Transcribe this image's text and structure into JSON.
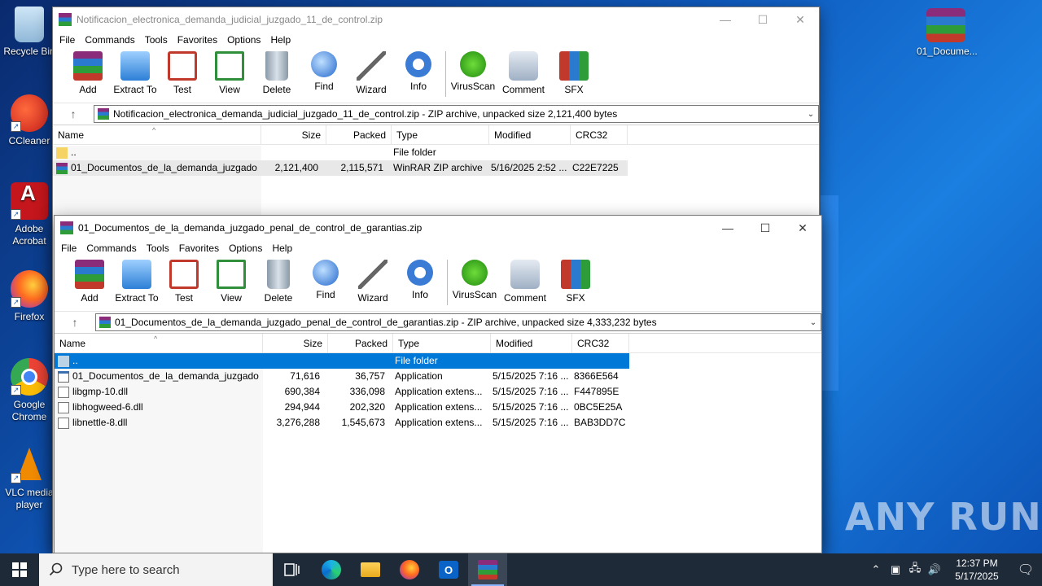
{
  "desktop": {
    "icons": [
      {
        "label": "Recycle Bin"
      },
      {
        "label": "CCleaner"
      },
      {
        "label": "Adobe Acrobat"
      },
      {
        "label": "Firefox"
      },
      {
        "label": "Google Chrome"
      },
      {
        "label": "VLC media player"
      }
    ],
    "file_icon_label": "01_Docume...",
    "watermark": "ANY RUN"
  },
  "window1": {
    "title": "Notificacion_electronica_demanda_judicial_juzgado_11_de_control.zip",
    "menu": [
      "File",
      "Commands",
      "Tools",
      "Favorites",
      "Options",
      "Help"
    ],
    "toolbar": [
      "Add",
      "Extract To",
      "Test",
      "View",
      "Delete",
      "Find",
      "Wizard",
      "Info",
      "VirusScan",
      "Comment",
      "SFX"
    ],
    "address": "Notificacion_electronica_demanda_judicial_juzgado_11_de_control.zip - ZIP archive, unpacked size 2,121,400 bytes",
    "columns": [
      "Name",
      "Size",
      "Packed",
      "Type",
      "Modified",
      "CRC32"
    ],
    "rows": [
      {
        "name": "..",
        "size": "",
        "packed": "",
        "type": "File folder",
        "modified": "",
        "crc": ""
      },
      {
        "name": "01_Documentos_de_la_demanda_juzgado...",
        "size": "2,121,400",
        "packed": "2,115,571",
        "type": "WinRAR ZIP archive",
        "modified": "5/16/2025 2:52 ...",
        "crc": "C22E7225"
      }
    ]
  },
  "window2": {
    "title": "01_Documentos_de_la_demanda_juzgado_penal_de_control_de_garantias.zip",
    "menu": [
      "File",
      "Commands",
      "Tools",
      "Favorites",
      "Options",
      "Help"
    ],
    "toolbar": [
      "Add",
      "Extract To",
      "Test",
      "View",
      "Delete",
      "Find",
      "Wizard",
      "Info",
      "VirusScan",
      "Comment",
      "SFX"
    ],
    "address": "01_Documentos_de_la_demanda_juzgado_penal_de_control_de_garantias.zip - ZIP archive, unpacked size 4,333,232 bytes",
    "columns": [
      "Name",
      "Size",
      "Packed",
      "Type",
      "Modified",
      "CRC32"
    ],
    "rows": [
      {
        "name": "..",
        "size": "",
        "packed": "",
        "type": "File folder",
        "modified": "",
        "crc": ""
      },
      {
        "name": "01_Documentos_de_la_demanda_juzgado...",
        "size": "71,616",
        "packed": "36,757",
        "type": "Application",
        "modified": "5/15/2025 7:16 ...",
        "crc": "8366E564"
      },
      {
        "name": "libgmp-10.dll",
        "size": "690,384",
        "packed": "336,098",
        "type": "Application extens...",
        "modified": "5/15/2025 7:16 ...",
        "crc": "F447895E"
      },
      {
        "name": "libhogweed-6.dll",
        "size": "294,944",
        "packed": "202,320",
        "type": "Application extens...",
        "modified": "5/15/2025 7:16 ...",
        "crc": "0BC5E25A"
      },
      {
        "name": "libnettle-8.dll",
        "size": "3,276,288",
        "packed": "1,545,673",
        "type": "Application extens...",
        "modified": "5/15/2025 7:16 ...",
        "crc": "BAB3DD7C"
      }
    ]
  },
  "taskbar": {
    "search_placeholder": "Type here to search",
    "time": "12:37 PM",
    "date": "5/17/2025"
  }
}
